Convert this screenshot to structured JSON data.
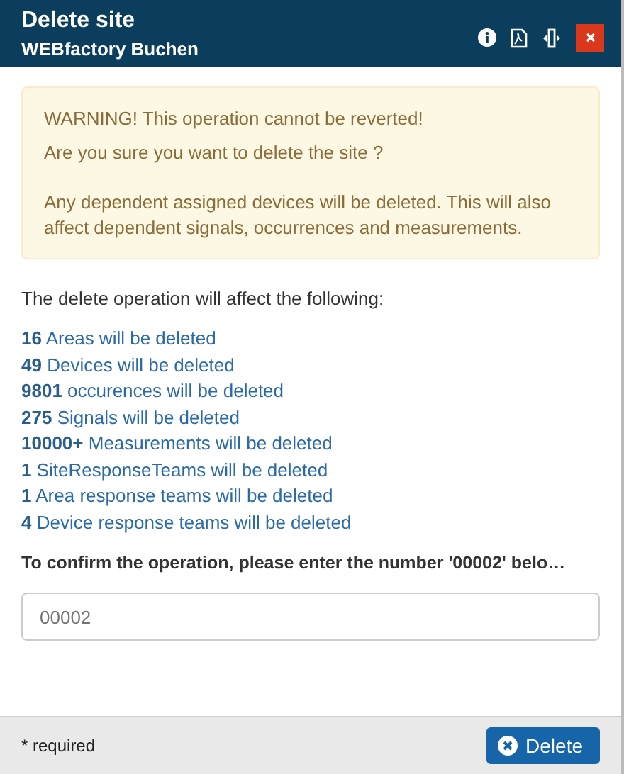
{
  "window": {
    "title": "Delete site",
    "subtitle": "WEBfactory Buchen"
  },
  "warning": [
    "WARNING! This operation cannot be reverted!",
    "Are you sure you want to delete the site ?",
    "Any dependent assigned devices will be deleted. This will also affect dependent signals, occurrences and measurements."
  ],
  "intro": "The delete operation will affect the following:",
  "effects": [
    "**16** Areas will be deleted",
    "**49** Devices will be deleted",
    "**9801** occurences will be deleted",
    "**275** Signals will be deleted",
    "**10000+** Measurements will be deleted",
    "**1** SiteResponseTeams will be deleted",
    "**1** Area response teams will be deleted",
    "**4** Device response teams will be deleted"
  ],
  "confirm_label": "To confirm the operation, please enter the number '00002' belo…",
  "confirm_field": {
    "placeholder": "00002"
  },
  "footer": {
    "note": "* required",
    "button": "Delete"
  }
}
